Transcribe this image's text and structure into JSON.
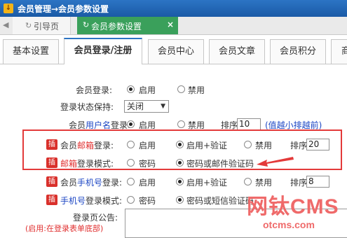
{
  "window": {
    "title": "会员管理→会员参数设置"
  },
  "page_tabs": [
    {
      "label": "引导页"
    },
    {
      "label": "会员参数设置",
      "close": "×"
    }
  ],
  "settings_tabs": [
    "基本设置",
    "会员登录/注册",
    "会员中心",
    "会员文章",
    "会员积分",
    "商"
  ],
  "form": {
    "member_login": {
      "label": "会员登录:",
      "options": [
        "启用",
        "禁用"
      ],
      "selected": "启用"
    },
    "login_keep": {
      "label": "登录状态保持:",
      "value": "关闭"
    },
    "username_login": {
      "label_prefix": "会员",
      "label_blue": "用户名",
      "label_suffix": "登录:",
      "options": [
        "启用",
        "禁用"
      ],
      "selected": "启用",
      "sort_label": "排序",
      "sort_value": "10",
      "sort_hint": "(值越小排越前)"
    },
    "email_login": {
      "badge": "插",
      "label_prefix": "会员",
      "label_red": "邮箱",
      "label_suffix": "登录:",
      "options": [
        "启用",
        "启用+验证",
        "禁用"
      ],
      "selected": "启用+验证",
      "sort_label": "排序",
      "sort_value": "20"
    },
    "email_mode": {
      "badge": "插",
      "label_red": "邮箱",
      "label_suffix": "登录模式:",
      "options": [
        "密码",
        "密码或邮件验证码"
      ],
      "selected": "密码或邮件验证码"
    },
    "mobile_login": {
      "badge": "插",
      "label_prefix": "会员",
      "label_blue": "手机号",
      "label_suffix": "登录:",
      "options": [
        "启用",
        "启用+验证",
        "禁用"
      ],
      "selected": "启用+验证",
      "sort_label": "排序",
      "sort_value": "8"
    },
    "mobile_mode": {
      "badge": "插",
      "label_blue": "手机号",
      "label_suffix": "登录模式:",
      "options": [
        "密码",
        "密码或短信验证码"
      ],
      "selected": "密码或短信验证码"
    },
    "login_notice": {
      "label": "登录页公告:",
      "hint": "(启用:在登录表单底部)"
    }
  },
  "watermark": {
    "main": "网钛CMS",
    "url": "otcms.com"
  },
  "colors": {
    "title_bar": "#1f62b0",
    "active_tab": "#3aa05b",
    "highlight": "#e33a3a",
    "badge": "#d9302b"
  }
}
